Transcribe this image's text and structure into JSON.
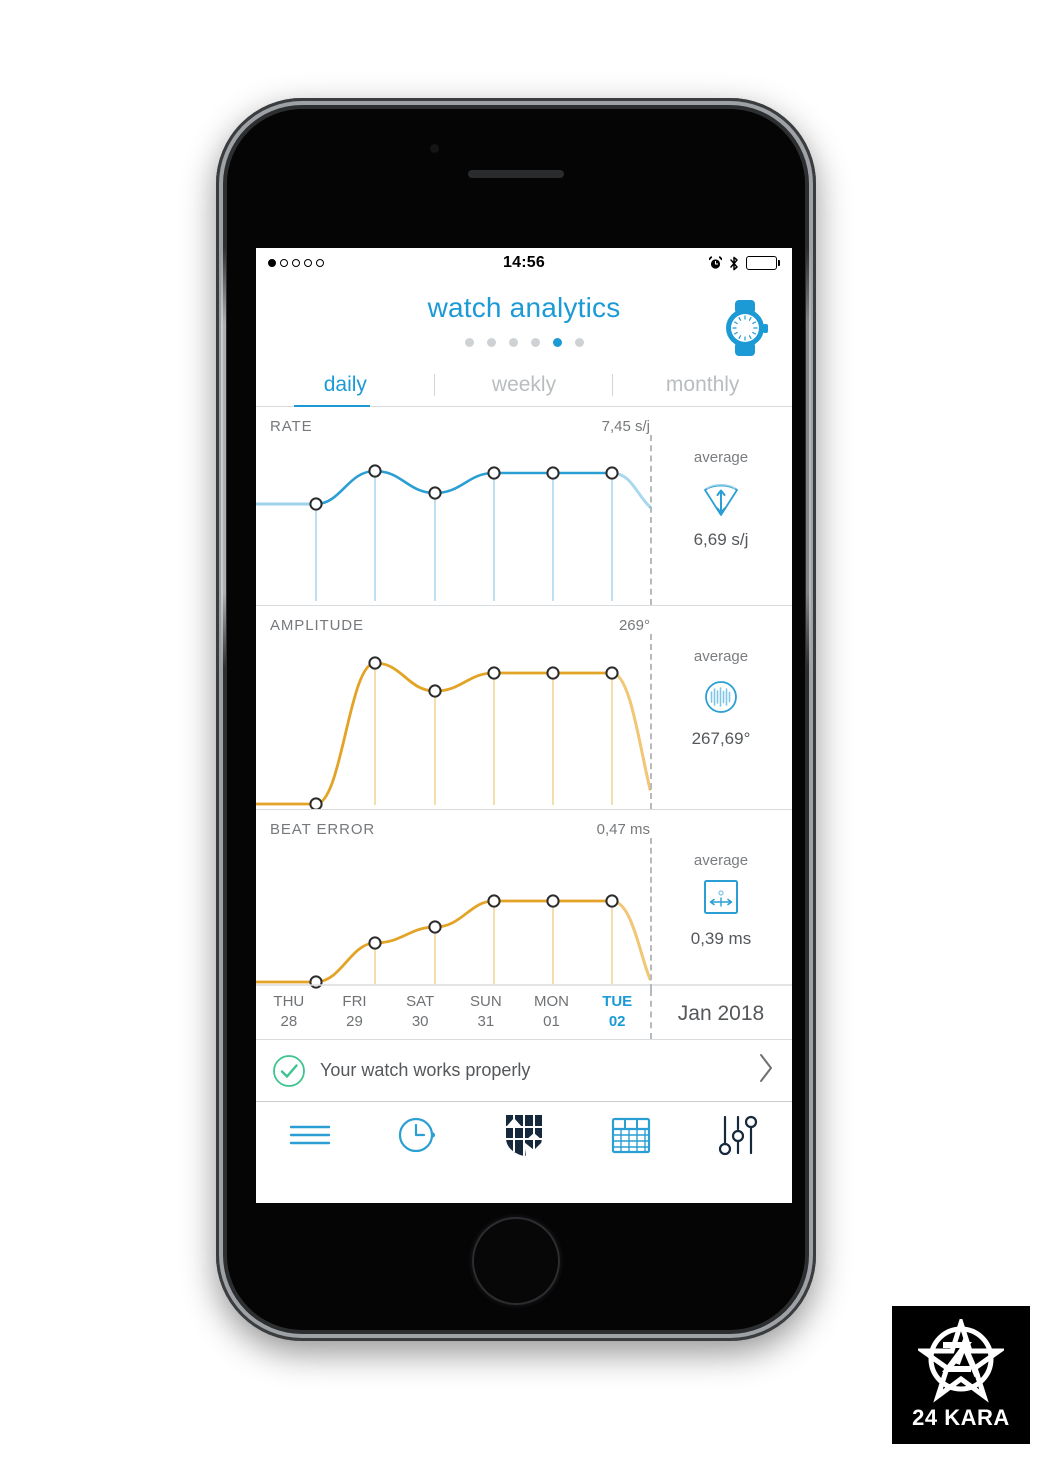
{
  "status_bar": {
    "time": "14:56",
    "signal_dots": [
      true,
      false,
      false,
      false,
      false
    ],
    "icons": [
      "alarm-icon",
      "bluetooth-icon",
      "battery-icon"
    ]
  },
  "header": {
    "title": "watch analytics",
    "watch_icon": "watch-icon",
    "page_dots_total": 6,
    "page_dots_active_index": 4
  },
  "tabs": [
    {
      "label": "daily",
      "active": true
    },
    {
      "label": "weekly",
      "active": false
    },
    {
      "label": "monthly",
      "active": false
    }
  ],
  "metrics": [
    {
      "label": "RATE",
      "value": "7,45 s/j",
      "avg_label": "average",
      "avg_value": "6,69 s/j",
      "avg_icon": "rate-cone-icon",
      "color": "#2b9fd4"
    },
    {
      "label": "AMPLITUDE",
      "value": "269°",
      "avg_label": "average",
      "avg_value": "267,69°",
      "avg_icon": "amplitude-waveform-icon",
      "color": "#e3a326"
    },
    {
      "label": "BEAT ERROR",
      "value": "0,47 ms",
      "avg_label": "average",
      "avg_value": "0,39 ms",
      "avg_icon": "beat-error-caliper-icon",
      "color": "#e3a326"
    }
  ],
  "date_axis": {
    "days": [
      {
        "dow": "THU",
        "num": "28",
        "active": false
      },
      {
        "dow": "FRI",
        "num": "29",
        "active": false
      },
      {
        "dow": "SAT",
        "num": "30",
        "active": false
      },
      {
        "dow": "SUN",
        "num": "31",
        "active": false
      },
      {
        "dow": "MON",
        "num": "01",
        "active": false
      },
      {
        "dow": "TUE",
        "num": "02",
        "active": true
      }
    ],
    "month": "Jan 2018"
  },
  "banner": {
    "text": "Your watch works properly",
    "status_icon": "check-circle-icon",
    "chevron_icon": "chevron-right-icon",
    "status_color": "#3dc48f"
  },
  "tabbar": [
    {
      "icon": "menu-lines-icon",
      "active": false
    },
    {
      "icon": "clock-icon",
      "active": false
    },
    {
      "icon": "shield-crest-icon",
      "active": true
    },
    {
      "icon": "calendar-icon",
      "active": false
    },
    {
      "icon": "sliders-icon",
      "active": false
    }
  ],
  "logo": {
    "word": "24 KARA",
    "mark": "za-anarchy-star-icon"
  },
  "colors": {
    "accent_blue": "#1c9ad6",
    "amber": "#e3a326",
    "grey_text": "#76797c",
    "navy": "#16293c"
  },
  "chart_data": [
    {
      "type": "line",
      "title": "RATE",
      "ylabel": "s/j",
      "xlabel": "",
      "categories": [
        "THU 28",
        "FRI 29",
        "SAT 30",
        "SUN 31",
        "MON 01",
        "TUE 02"
      ],
      "values": [
        5.9,
        7.6,
        6.5,
        7.45,
        7.45,
        7.45
      ],
      "latest_value": "7,45 s/j",
      "average": "6,69 s/j",
      "ylim": [
        5.0,
        8.0
      ],
      "grid": false,
      "legend": "none",
      "series_color": "#2b9fd4"
    },
    {
      "type": "line",
      "title": "AMPLITUDE",
      "ylabel": "degrees",
      "xlabel": "",
      "categories": [
        "THU 28",
        "FRI 29",
        "SAT 30",
        "SUN 31",
        "MON 01",
        "TUE 02"
      ],
      "values": [
        0,
        272,
        263,
        269,
        269,
        269
      ],
      "latest_value": "269°",
      "average": "267,69°",
      "ylim": [
        0,
        280
      ],
      "grid": false,
      "legend": "none",
      "series_color": "#e3a326"
    },
    {
      "type": "line",
      "title": "BEAT ERROR",
      "ylabel": "ms",
      "xlabel": "",
      "categories": [
        "THU 28",
        "FRI 29",
        "SAT 30",
        "SUN 31",
        "MON 01",
        "TUE 02"
      ],
      "values": [
        0.0,
        0.22,
        0.31,
        0.47,
        0.47,
        0.47
      ],
      "latest_value": "0,47 ms",
      "average": "0,39 ms",
      "ylim": [
        0,
        0.55
      ],
      "grid": false,
      "legend": "none",
      "series_color": "#e3a326"
    }
  ]
}
